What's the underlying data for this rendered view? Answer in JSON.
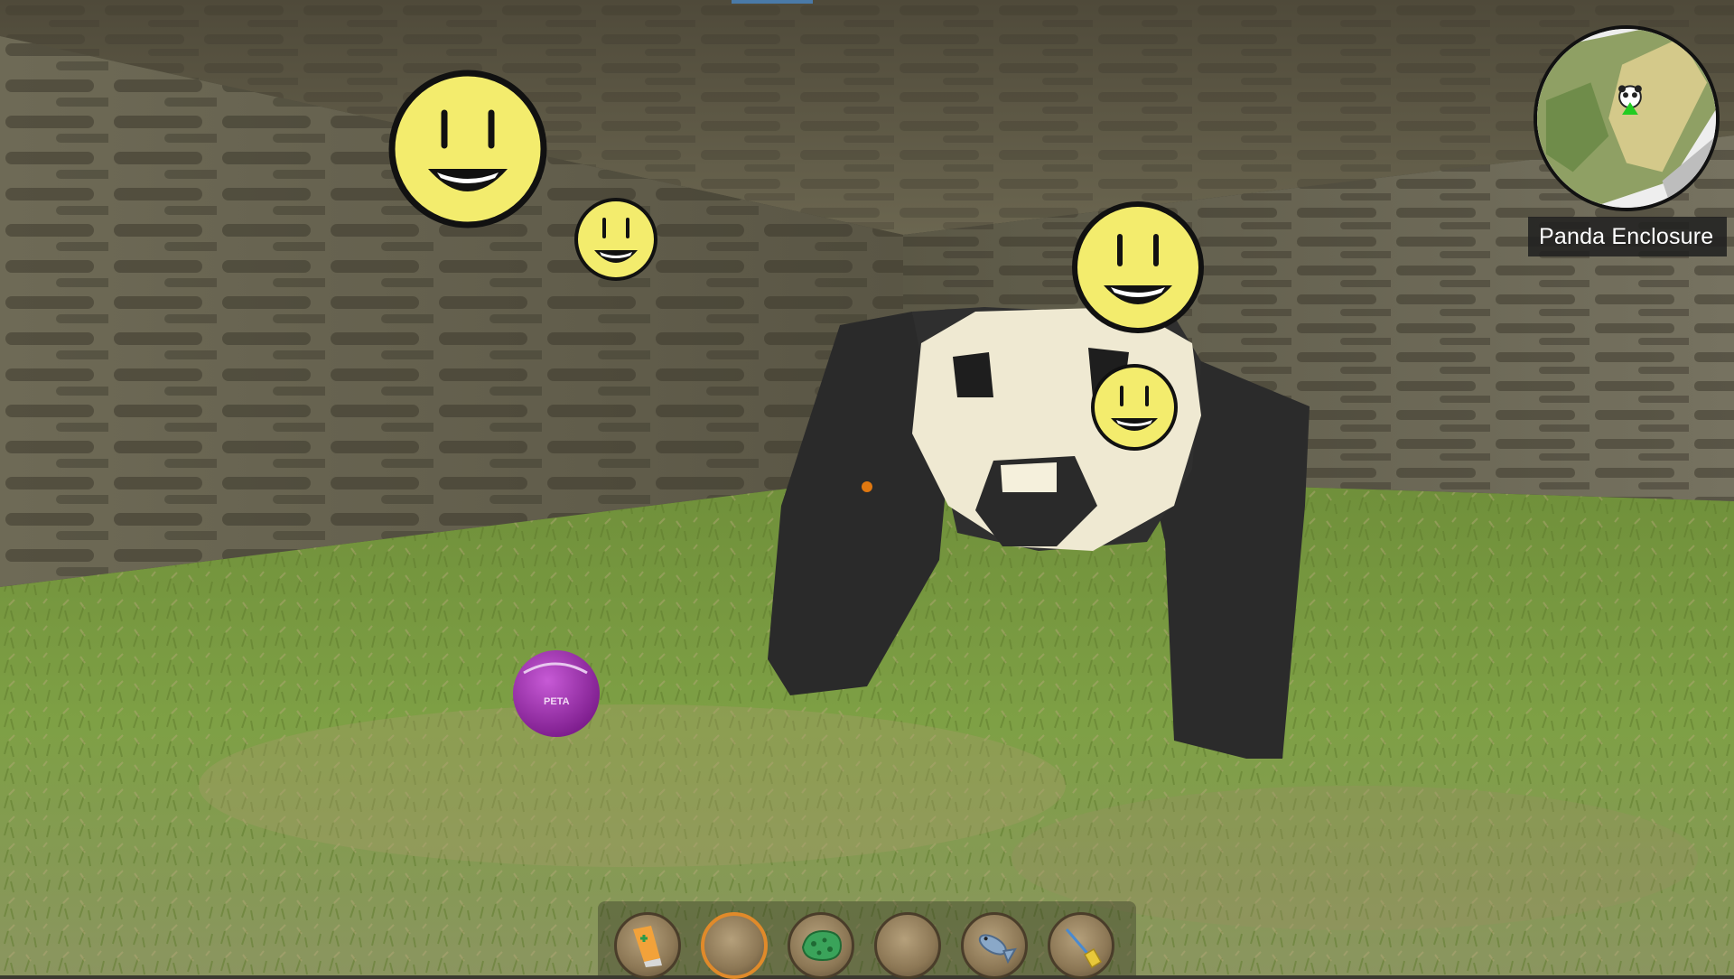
{
  "location": {
    "name": "Panda Enclosure"
  },
  "colors": {
    "crosshair": "#e07810",
    "selected_slot": "#e08a2a",
    "minimap_player": "#22cc22"
  },
  "hotbar": {
    "selected_index": 1,
    "slots": [
      {
        "icon": "ointment-tube-icon"
      },
      {
        "icon": "empty-slot"
      },
      {
        "icon": "sponge-icon"
      },
      {
        "icon": "empty-slot"
      },
      {
        "icon": "fish-icon"
      },
      {
        "icon": "broom-icon"
      }
    ]
  },
  "scene": {
    "subject": "panda-icon",
    "happiness_indicator": "smiley-face-icon",
    "ball_text": "PETA"
  }
}
